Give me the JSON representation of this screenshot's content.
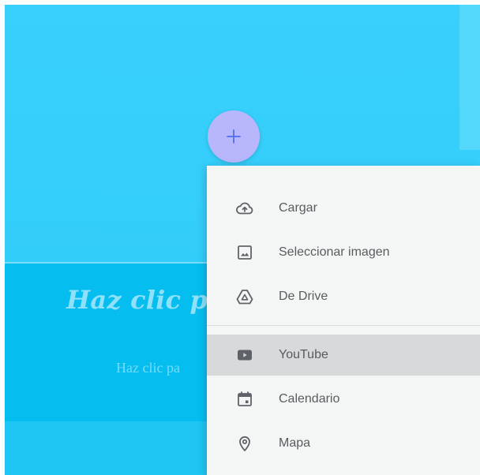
{
  "canvas": {
    "title_placeholder": "Haz clic par",
    "subtitle_placeholder": "Haz clic pa"
  },
  "add_button": {
    "icon": "plus-icon"
  },
  "insert_menu": {
    "items": [
      {
        "label": "Cargar",
        "icon": "cloud-upload-icon"
      },
      {
        "label": "Seleccionar imagen",
        "icon": "image-icon"
      },
      {
        "label": "De Drive",
        "icon": "drive-icon"
      },
      {
        "label": "YouTube",
        "icon": "youtube-icon"
      },
      {
        "label": "Calendario",
        "icon": "calendar-icon"
      },
      {
        "label": "Mapa",
        "icon": "map-pin-icon"
      }
    ],
    "highlighted_item": "YouTube"
  },
  "colors": {
    "background_cyan": "#35cdfb",
    "text_band_cyan": "#06bdf0",
    "fab_purple": "#b9b7fb",
    "menu_background": "#f4f6f6",
    "highlight_gray": "#d7d9da",
    "icon_gray": "#5f6368"
  }
}
